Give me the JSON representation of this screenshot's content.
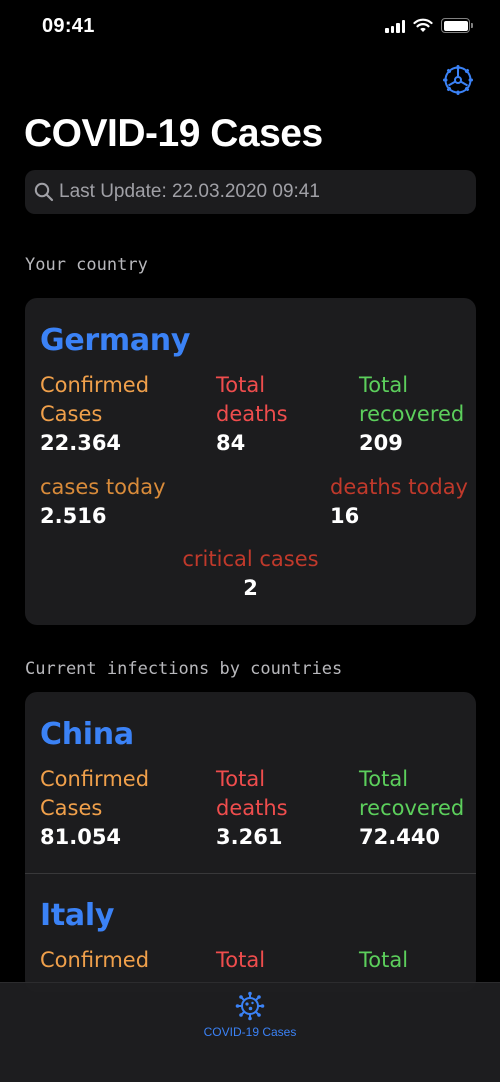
{
  "status_bar": {
    "time": "09:41"
  },
  "nav": {
    "title": "COVID-19 Cases"
  },
  "search": {
    "text": "Last Update: 22.03.2020 09:41"
  },
  "your_country": {
    "header": "Your country",
    "name": "Germany",
    "confirmed_label_1": "Confirmed",
    "confirmed_label_2": "Cases",
    "confirmed": "22.364",
    "deaths_label_1": "Total",
    "deaths_label_2": "deaths",
    "deaths": "84",
    "recovered_label_1": "Total",
    "recovered_label_2": "recovered",
    "recovered": "209",
    "cases_today_label": "cases today",
    "cases_today": "2.516",
    "deaths_today_label": "deaths today",
    "deaths_today": "16",
    "critical_label": "critical cases",
    "critical": "2"
  },
  "by_countries": {
    "header": "Current infections by countries",
    "countries": [
      {
        "name": "China",
        "confirmed_label_1": "Confirmed",
        "confirmed_label_2": "Cases",
        "confirmed": "81.054",
        "deaths_label_1": "Total",
        "deaths_label_2": "deaths",
        "deaths": "3.261",
        "recovered_label_1": "Total",
        "recovered_label_2": "recovered",
        "recovered": "72.440"
      },
      {
        "name": "Italy",
        "confirmed_label_1": "Confirmed",
        "deaths_label_1": "Total",
        "recovered_label_1": "Total"
      }
    ]
  },
  "tab_bar": {
    "active_tab": "COVID-19 Cases",
    "accent": "#3b82f6"
  },
  "icons": {
    "settings": "gear-icon",
    "search": "search-icon",
    "tab": "virus-icon"
  }
}
